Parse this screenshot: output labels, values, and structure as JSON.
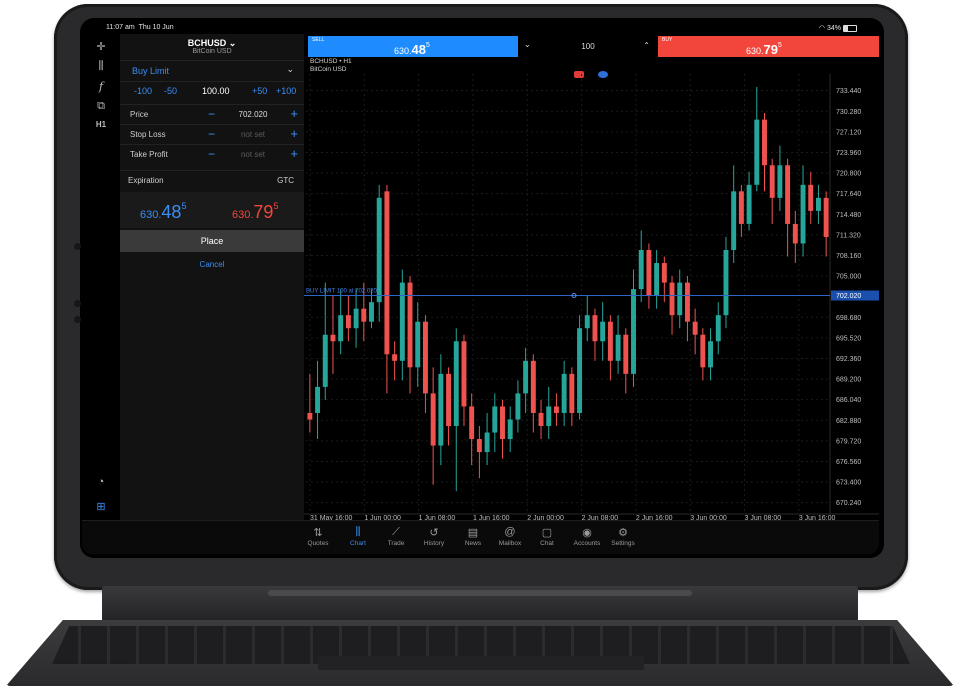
{
  "status": {
    "time": "11:07 am",
    "date": "Thu 10 Jun",
    "battery": "34%"
  },
  "toolbar": {
    "tool_h1": "H1"
  },
  "order": {
    "symbol": "BCHUSD",
    "symbol_desc": "BitCoin USD",
    "type": "Buy Limit",
    "qty_minus100": "-100",
    "qty_minus50": "-50",
    "qty_value": "100.00",
    "qty_plus50": "+50",
    "qty_plus100": "+100",
    "price_label": "Price",
    "price_value": "702.020",
    "sl_label": "Stop Loss",
    "sl_value": "not set",
    "tp_label": "Take Profit",
    "tp_value": "not set",
    "exp_label": "Expiration",
    "exp_value": "GTC",
    "bid_small": "630.",
    "bid_big": "48",
    "bid_sup": "5",
    "ask_small": "630.",
    "ask_big": "79",
    "ask_sup": "5",
    "place_label": "Place",
    "cancel_label": "Cancel"
  },
  "chart_header": {
    "sell_label": "SELL",
    "sell_small": "630.",
    "sell_big": "48",
    "sell_sup": "5",
    "volume": "100",
    "buy_label": "BUY",
    "buy_small": "630.",
    "buy_big": "79",
    "buy_sup": "5",
    "chart_title": "BCHUSD • H1",
    "chart_sub": "BitCoin USD",
    "order_line_label": "BUY LIMIT 100 at 702.020",
    "order_line_price": "702.020"
  },
  "chart_data": {
    "type": "candlestick",
    "y_ticks": [
      "733.440",
      "730.280",
      "727.120",
      "723.960",
      "720.800",
      "717.640",
      "714.480",
      "711.320",
      "708.160",
      "705.000",
      "698.680",
      "695.520",
      "692.360",
      "689.200",
      "686.040",
      "682.880",
      "679.720",
      "676.560",
      "673.400",
      "670.240"
    ],
    "x_ticks": [
      "31 May 16:00",
      "1 Jun 00:00",
      "1 Jun 08:00",
      "1 Jun 16:00",
      "2 Jun 00:00",
      "2 Jun 08:00",
      "2 Jun 16:00",
      "3 Jun 00:00",
      "3 Jun 08:00",
      "3 Jun 16:00"
    ],
    "ylim": [
      668.5,
      736.0
    ],
    "order_line": 702.02,
    "up_color": "#26a69a",
    "down_color": "#ef5350",
    "candles": [
      {
        "o": 684.0,
        "c": 683.0,
        "h": 690.0,
        "l": 681.0
      },
      {
        "o": 684.0,
        "c": 688.0,
        "h": 692.0,
        "l": 680.0
      },
      {
        "o": 688.0,
        "c": 696.0,
        "h": 704.0,
        "l": 686.0
      },
      {
        "o": 696.0,
        "c": 695.0,
        "h": 702.0,
        "l": 690.0
      },
      {
        "o": 695.0,
        "c": 699.0,
        "h": 703.0,
        "l": 693.0
      },
      {
        "o": 699.0,
        "c": 697.0,
        "h": 702.0,
        "l": 695.0
      },
      {
        "o": 697.0,
        "c": 700.0,
        "h": 703.0,
        "l": 694.0
      },
      {
        "o": 700.0,
        "c": 698.0,
        "h": 704.0,
        "l": 695.0
      },
      {
        "o": 698.0,
        "c": 701.0,
        "h": 703.0,
        "l": 697.0
      },
      {
        "o": 701.0,
        "c": 717.0,
        "h": 719.0,
        "l": 698.0
      },
      {
        "o": 718.0,
        "c": 693.0,
        "h": 719.0,
        "l": 687.0
      },
      {
        "o": 693.0,
        "c": 692.0,
        "h": 695.0,
        "l": 689.0
      },
      {
        "o": 692.0,
        "c": 704.0,
        "h": 706.0,
        "l": 689.0
      },
      {
        "o": 704.0,
        "c": 691.0,
        "h": 705.0,
        "l": 687.0
      },
      {
        "o": 691.0,
        "c": 698.0,
        "h": 701.0,
        "l": 688.0
      },
      {
        "o": 698.0,
        "c": 687.0,
        "h": 699.0,
        "l": 684.0
      },
      {
        "o": 687.0,
        "c": 679.0,
        "h": 691.0,
        "l": 673.0
      },
      {
        "o": 679.0,
        "c": 690.0,
        "h": 693.0,
        "l": 676.0
      },
      {
        "o": 690.0,
        "c": 682.0,
        "h": 691.0,
        "l": 679.0
      },
      {
        "o": 682.0,
        "c": 695.0,
        "h": 697.0,
        "l": 672.0
      },
      {
        "o": 695.0,
        "c": 685.0,
        "h": 696.0,
        "l": 682.0
      },
      {
        "o": 685.0,
        "c": 680.0,
        "h": 687.0,
        "l": 676.0
      },
      {
        "o": 680.0,
        "c": 678.0,
        "h": 682.0,
        "l": 674.0
      },
      {
        "o": 678.0,
        "c": 681.0,
        "h": 684.0,
        "l": 676.0
      },
      {
        "o": 681.0,
        "c": 685.0,
        "h": 687.0,
        "l": 678.0
      },
      {
        "o": 685.0,
        "c": 680.0,
        "h": 686.0,
        "l": 677.0
      },
      {
        "o": 680.0,
        "c": 683.0,
        "h": 685.0,
        "l": 678.0
      },
      {
        "o": 683.0,
        "c": 687.0,
        "h": 689.0,
        "l": 681.0
      },
      {
        "o": 687.0,
        "c": 692.0,
        "h": 694.0,
        "l": 684.0
      },
      {
        "o": 692.0,
        "c": 684.0,
        "h": 693.0,
        "l": 681.0
      },
      {
        "o": 684.0,
        "c": 682.0,
        "h": 686.0,
        "l": 680.0
      },
      {
        "o": 682.0,
        "c": 685.0,
        "h": 688.0,
        "l": 680.0
      },
      {
        "o": 685.0,
        "c": 684.0,
        "h": 687.0,
        "l": 682.0
      },
      {
        "o": 684.0,
        "c": 690.0,
        "h": 692.0,
        "l": 682.0
      },
      {
        "o": 690.0,
        "c": 684.0,
        "h": 691.0,
        "l": 682.0
      },
      {
        "o": 684.0,
        "c": 697.0,
        "h": 699.0,
        "l": 683.0
      },
      {
        "o": 697.0,
        "c": 699.0,
        "h": 702.0,
        "l": 695.0
      },
      {
        "o": 699.0,
        "c": 695.0,
        "h": 700.0,
        "l": 692.0
      },
      {
        "o": 695.0,
        "c": 698.0,
        "h": 701.0,
        "l": 692.0
      },
      {
        "o": 698.0,
        "c": 692.0,
        "h": 699.0,
        "l": 689.0
      },
      {
        "o": 692.0,
        "c": 696.0,
        "h": 699.0,
        "l": 690.0
      },
      {
        "o": 696.0,
        "c": 690.0,
        "h": 697.0,
        "l": 687.0
      },
      {
        "o": 690.0,
        "c": 703.0,
        "h": 706.0,
        "l": 688.0
      },
      {
        "o": 703.0,
        "c": 709.0,
        "h": 712.0,
        "l": 701.0
      },
      {
        "o": 709.0,
        "c": 702.0,
        "h": 710.0,
        "l": 700.0
      },
      {
        "o": 702.0,
        "c": 707.0,
        "h": 709.0,
        "l": 700.0
      },
      {
        "o": 707.0,
        "c": 704.0,
        "h": 708.0,
        "l": 701.0
      },
      {
        "o": 704.0,
        "c": 699.0,
        "h": 705.0,
        "l": 696.0
      },
      {
        "o": 699.0,
        "c": 704.0,
        "h": 706.0,
        "l": 697.0
      },
      {
        "o": 704.0,
        "c": 698.0,
        "h": 705.0,
        "l": 695.0
      },
      {
        "o": 698.0,
        "c": 696.0,
        "h": 700.0,
        "l": 693.0
      },
      {
        "o": 696.0,
        "c": 691.0,
        "h": 697.0,
        "l": 689.0
      },
      {
        "o": 691.0,
        "c": 695.0,
        "h": 697.0,
        "l": 689.0
      },
      {
        "o": 695.0,
        "c": 699.0,
        "h": 701.0,
        "l": 693.0
      },
      {
        "o": 699.0,
        "c": 709.0,
        "h": 711.0,
        "l": 697.0
      },
      {
        "o": 709.0,
        "c": 718.0,
        "h": 722.0,
        "l": 707.0
      },
      {
        "o": 718.0,
        "c": 713.0,
        "h": 719.0,
        "l": 711.0
      },
      {
        "o": 713.0,
        "c": 719.0,
        "h": 721.0,
        "l": 712.0
      },
      {
        "o": 719.0,
        "c": 729.0,
        "h": 734.0,
        "l": 718.0
      },
      {
        "o": 729.0,
        "c": 722.0,
        "h": 730.0,
        "l": 718.0
      },
      {
        "o": 722.0,
        "c": 717.0,
        "h": 723.0,
        "l": 713.0
      },
      {
        "o": 717.0,
        "c": 722.0,
        "h": 725.0,
        "l": 715.0
      },
      {
        "o": 722.0,
        "c": 713.0,
        "h": 723.0,
        "l": 708.0
      },
      {
        "o": 713.0,
        "c": 710.0,
        "h": 715.0,
        "l": 707.0
      },
      {
        "o": 710.0,
        "c": 719.0,
        "h": 722.0,
        "l": 708.0
      },
      {
        "o": 719.0,
        "c": 715.0,
        "h": 721.0,
        "l": 713.0
      },
      {
        "o": 715.0,
        "c": 717.0,
        "h": 719.0,
        "l": 713.0
      },
      {
        "o": 717.0,
        "c": 711.0,
        "h": 718.0,
        "l": 708.0
      }
    ]
  },
  "tabs": [
    {
      "label": "Quotes",
      "icon": "⇅"
    },
    {
      "label": "Chart",
      "icon": "⫼"
    },
    {
      "label": "Trade",
      "icon": "⟋"
    },
    {
      "label": "History",
      "icon": "↺"
    },
    {
      "label": "News",
      "icon": "▤"
    },
    {
      "label": "Mailbox",
      "icon": "@"
    },
    {
      "label": "Chat",
      "icon": "▢"
    },
    {
      "label": "Accounts",
      "icon": "◉"
    },
    {
      "label": "Settings",
      "icon": "⚙"
    }
  ]
}
